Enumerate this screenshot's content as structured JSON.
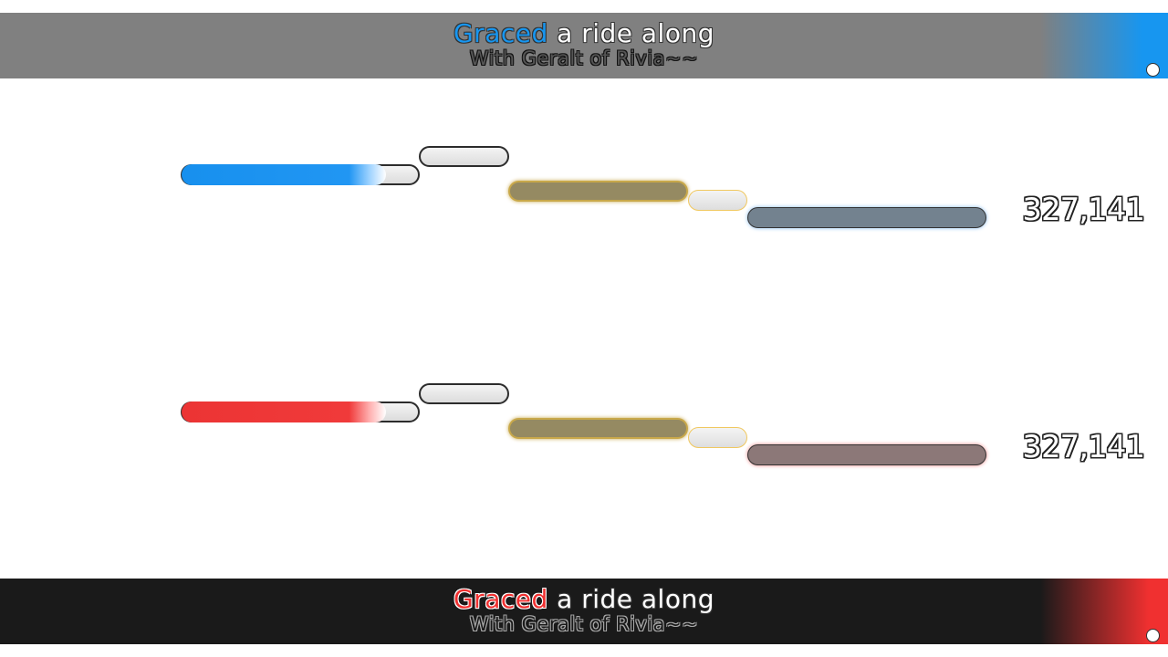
{
  "player1": {
    "color": "#1796f0",
    "score": "327,141",
    "lyrics": {
      "sung": "Graced",
      "rest": " a ride along",
      "next": "With Geralt of Rivia~~"
    },
    "progress": 0.86
  },
  "player2": {
    "color": "#f03030",
    "score": "327,141",
    "lyrics": {
      "sung": "Graced",
      "rest": " a ride along",
      "next": "With Geralt of Rivia~~"
    },
    "progress": 0.86
  }
}
